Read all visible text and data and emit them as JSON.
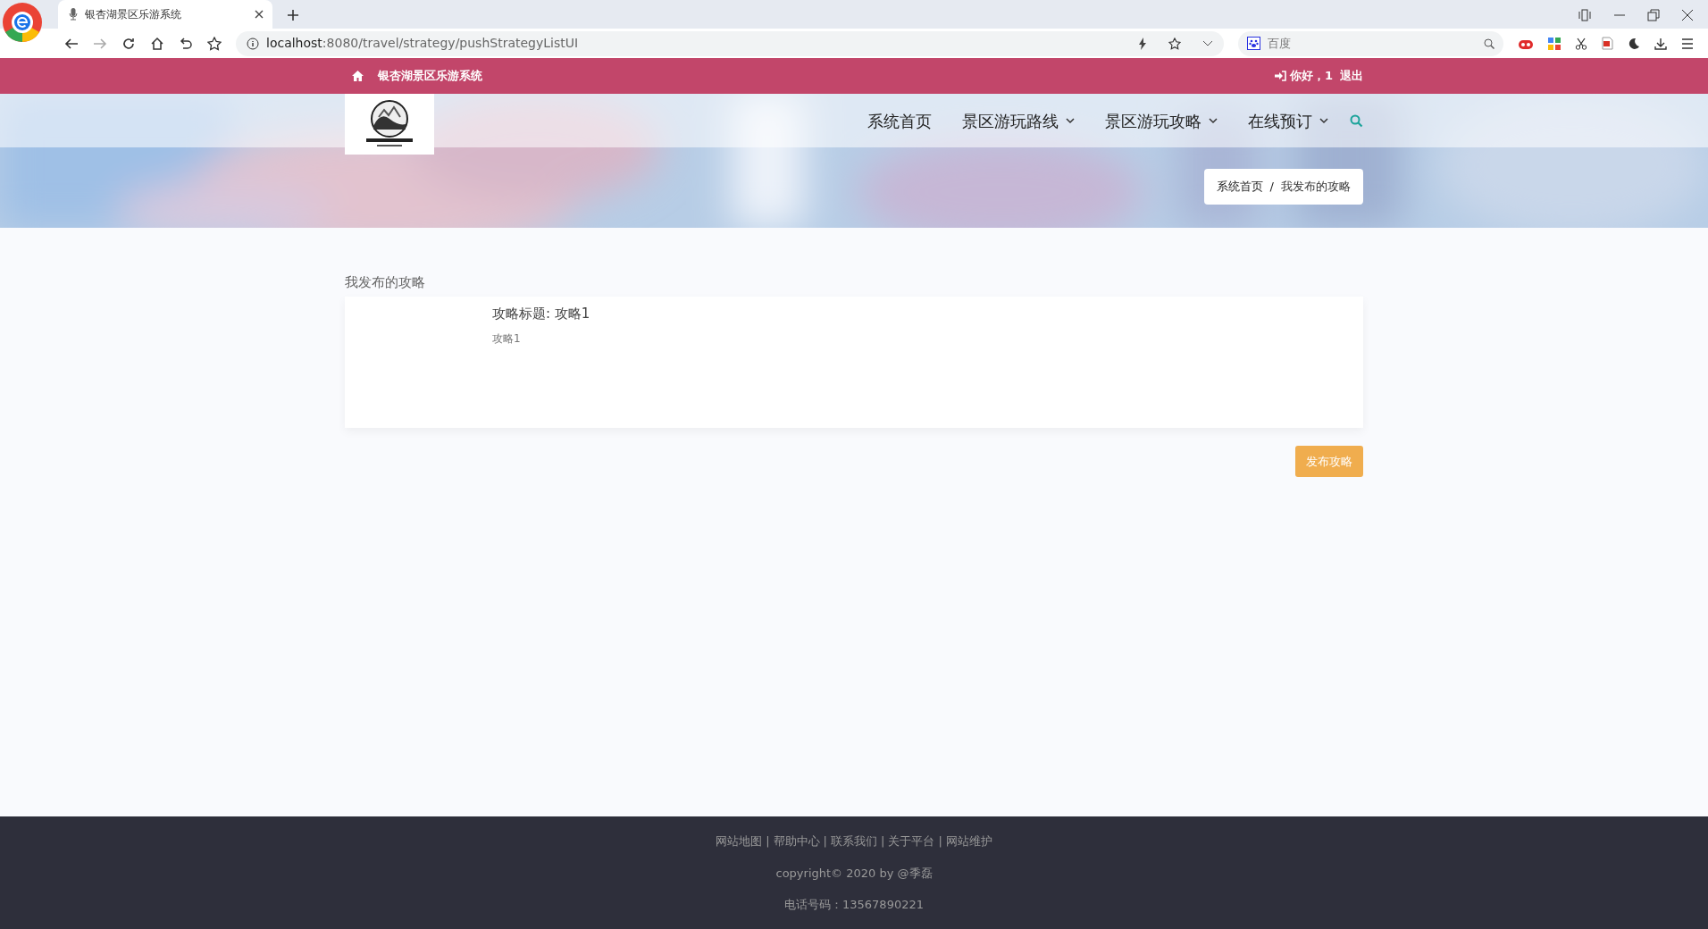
{
  "browser": {
    "tab_title": "银杏湖景区乐游系统",
    "url_host": "localhost",
    "url_path": ":8080/travel/strategy/pushStrategyListUI",
    "search_placeholder": "百度"
  },
  "topbar": {
    "site_name": "银杏湖景区乐游系统",
    "greeting": "你好，1",
    "logout": "退出"
  },
  "nav": {
    "items": [
      {
        "label": "系统首页",
        "dropdown": false
      },
      {
        "label": "景区游玩路线",
        "dropdown": true
      },
      {
        "label": "景区游玩攻略",
        "dropdown": true
      },
      {
        "label": "在线预订",
        "dropdown": true
      }
    ]
  },
  "breadcrumb": {
    "separator": "/",
    "items": [
      {
        "label": "系统首页",
        "active": false
      },
      {
        "label": "我发布的攻略",
        "active": true
      }
    ]
  },
  "page": {
    "heading": "我发布的攻略",
    "strategies": [
      {
        "title": "攻略标题: 攻略1",
        "summary": "攻略1"
      }
    ],
    "publish_button": "发布攻略"
  },
  "footer": {
    "separator": "|",
    "links": [
      "网站地图",
      "帮助中心",
      "联系我们",
      "关于平台",
      "网站维护"
    ],
    "copyright": "copyright© 2020 by @季磊",
    "phone": "电话号码：13567890221"
  }
}
